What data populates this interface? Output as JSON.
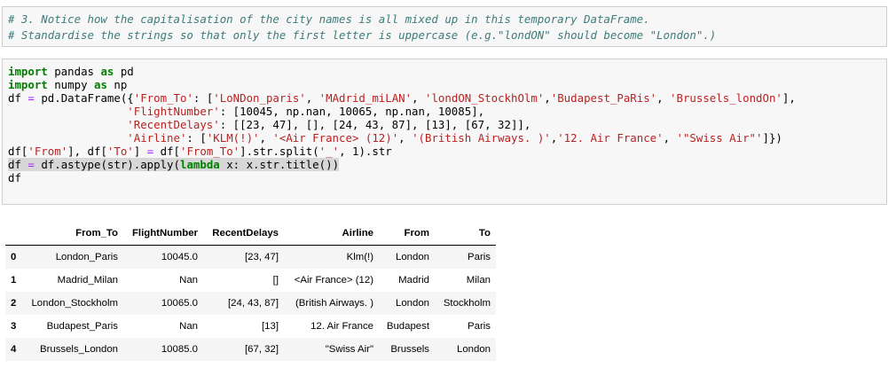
{
  "comment_cell": {
    "lines": [
      "# 3. Notice how the capitalisation of the city names is all mixed up in this temporary DataFrame.",
      "# Standardise the strings so that only the first letter is uppercase (e.g.\"londON\" should become \"London\".)"
    ]
  },
  "code_cell": {
    "l1": {
      "kw": "import",
      "rest": " pandas ",
      "kw2": "as",
      "rest2": " pd"
    },
    "l2": {
      "kw": "import",
      "rest": " numpy ",
      "kw2": "as",
      "rest2": " np"
    },
    "l3": {
      "a": "df ",
      "op": "=",
      "b": " pd.DataFrame({",
      "s1": "'From_To'",
      "c": ": [",
      "s2": "'LoNDon_paris'",
      "d": ", ",
      "s3": "'MAdrid_miLAN'",
      "e": ", ",
      "s4": "'londON_StockhOlm'",
      "f": ",",
      "s5": "'Budapest_PaRis'",
      "g": ", ",
      "s6": "'Brussels_londOn'",
      "h": "],"
    },
    "l4": {
      "pad": "                  ",
      "s1": "'FlightNumber'",
      "rest": ": [10045, np.nan, 10065, np.nan, 10085],"
    },
    "l5": {
      "pad": "                  ",
      "s1": "'RecentDelays'",
      "rest": ": [[23, 47], [], [24, 43, 87], [13], [67, 32]],"
    },
    "l6": {
      "pad": "                  ",
      "s1": "'Airline'",
      "a": ": [",
      "s2": "'KLM(!)'",
      "b": ", ",
      "s3": "'<Air France> (12)'",
      "c": ", ",
      "s4": "'(British Airways. )'",
      "d": ",",
      "s5": "'12. Air France'",
      "e": ", ",
      "s6": "'\"Swiss Air\"'",
      "f": "]})"
    },
    "l7": {
      "a": "df[",
      "s1": "'From'",
      "b": "], df[",
      "s2": "'To'",
      "c": "] ",
      "op": "=",
      "d": " df[",
      "s3": "'From_To'",
      "e": "].str.split(",
      "s4": "'_'",
      "f": ", 1).str"
    },
    "l8": {
      "a": "df ",
      "op": "=",
      "b": " df.astype(str).apply(",
      "kw": "lambda",
      "c": " x: x.str.title())"
    },
    "l9": {
      "a": "df"
    }
  },
  "dataframe": {
    "columns": [
      "From_To",
      "FlightNumber",
      "RecentDelays",
      "Airline",
      "From",
      "To"
    ],
    "rows": [
      {
        "index": "0",
        "cells": [
          "London_Paris",
          "10045.0",
          "[23, 47]",
          "Klm(!)",
          "London",
          "Paris"
        ]
      },
      {
        "index": "1",
        "cells": [
          "Madrid_Milan",
          "Nan",
          "[]",
          "<Air France> (12)",
          "Madrid",
          "Milan"
        ]
      },
      {
        "index": "2",
        "cells": [
          "London_Stockholm",
          "10065.0",
          "[24, 43, 87]",
          "(British Airways. )",
          "London",
          "Stockholm"
        ]
      },
      {
        "index": "3",
        "cells": [
          "Budapest_Paris",
          "Nan",
          "[13]",
          "12. Air France",
          "Budapest",
          "Paris"
        ]
      },
      {
        "index": "4",
        "cells": [
          "Brussels_London",
          "10085.0",
          "[67, 32]",
          "\"Swiss Air\"",
          "Brussels",
          "London"
        ]
      }
    ]
  }
}
